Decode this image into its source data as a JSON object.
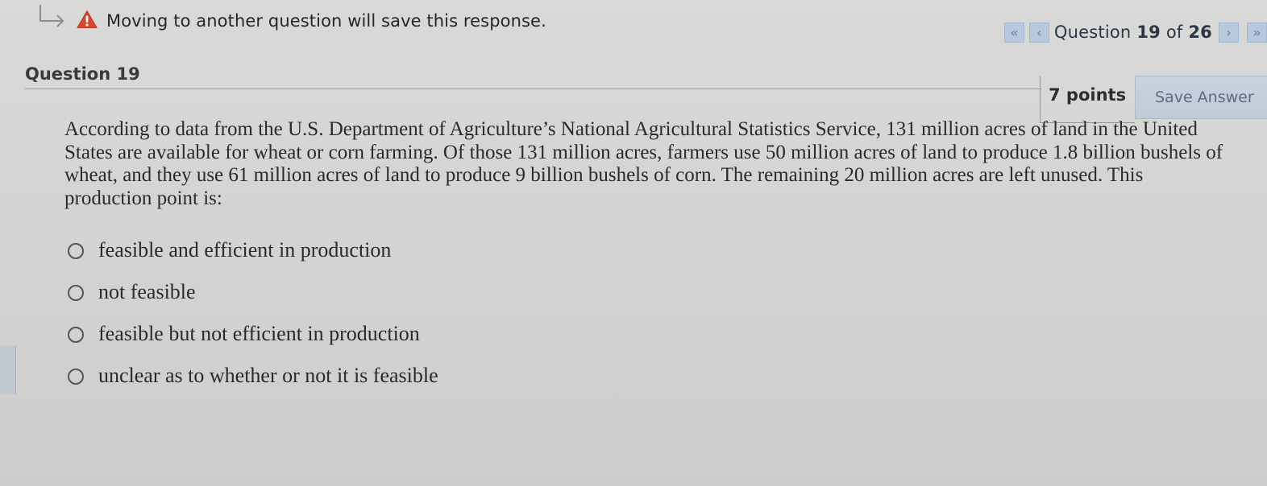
{
  "warning": {
    "text": "Moving to another question will save this response.",
    "icon": "warning-triangle-icon",
    "arrow_icon": "enter-arrow-icon",
    "icon_color": "#d9472b"
  },
  "navigation": {
    "first_glyph": "«",
    "prev_glyph": "‹",
    "next_glyph": "›",
    "last_glyph": "»",
    "label_prefix": "Question",
    "current": "19",
    "label_mid": "of",
    "total": "26",
    "button_color": "#b9c9dd"
  },
  "question": {
    "title": "Question 19",
    "points": "7 points",
    "save_label": "Save Answer",
    "prompt": "According to data from the U.S. Department of Agriculture’s National Agricultural Statistics Service, 131 million acres of land in the United States are available for wheat or corn farming. Of those 131 million acres, farmers use 50 million acres of land to produce 1.8 billion bushels of wheat, and they use 61 million acres of land to produce 9 billion bushels of corn. The remaining 20 million acres are left unused. This production point is:",
    "choices": [
      {
        "label": "feasible and efficient in production"
      },
      {
        "label": "not feasible"
      },
      {
        "label": "feasible but not efficient in production"
      },
      {
        "label": "unclear as to whether or not it is feasible"
      }
    ]
  }
}
